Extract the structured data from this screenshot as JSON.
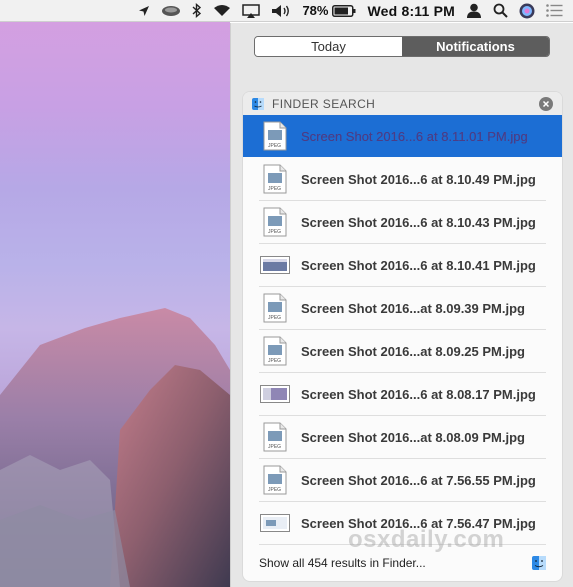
{
  "menubar": {
    "battery_percent": "78%",
    "clock": "Wed 8:11 PM"
  },
  "notification_center": {
    "tabs": [
      {
        "label": "Today",
        "selected": false
      },
      {
        "label": "Notifications",
        "selected": true
      }
    ],
    "widget": {
      "title": "FINDER SEARCH",
      "results": [
        {
          "name": "Screen Shot 2016...6 at 8.11.01 PM.jpg",
          "icon": "jpeg-file-icon",
          "selected": true
        },
        {
          "name": "Screen Shot 2016...6 at 8.10.49 PM.jpg",
          "icon": "jpeg-file-icon",
          "selected": false
        },
        {
          "name": "Screen Shot 2016...6 at 8.10.43 PM.jpg",
          "icon": "jpeg-file-icon",
          "selected": false
        },
        {
          "name": "Screen Shot 2016...6 at 8.10.41 PM.jpg",
          "icon": "image-thumbnail-icon",
          "selected": false
        },
        {
          "name": "Screen Shot 2016...at 8.09.39 PM.jpg",
          "icon": "jpeg-file-icon",
          "selected": false
        },
        {
          "name": "Screen Shot 2016...at 8.09.25 PM.jpg",
          "icon": "jpeg-file-icon",
          "selected": false
        },
        {
          "name": "Screen Shot 2016...6 at 8.08.17 PM.jpg",
          "icon": "image-thumbnail-icon",
          "selected": false
        },
        {
          "name": "Screen Shot 2016...at 8.08.09 PM.jpg",
          "icon": "jpeg-file-icon",
          "selected": false
        },
        {
          "name": "Screen Shot 2016...6 at 7.56.55 PM.jpg",
          "icon": "jpeg-file-icon",
          "selected": false
        },
        {
          "name": "Screen Shot 2016...6 at 7.56.47 PM.jpg",
          "icon": "image-thumbnail-icon",
          "selected": false
        }
      ],
      "footer": "Show all 454 results in Finder..."
    }
  },
  "watermark": "osxdaily.com",
  "colors": {
    "selection": "#1c6ed4",
    "segment_selected": "#5d5d5d"
  }
}
